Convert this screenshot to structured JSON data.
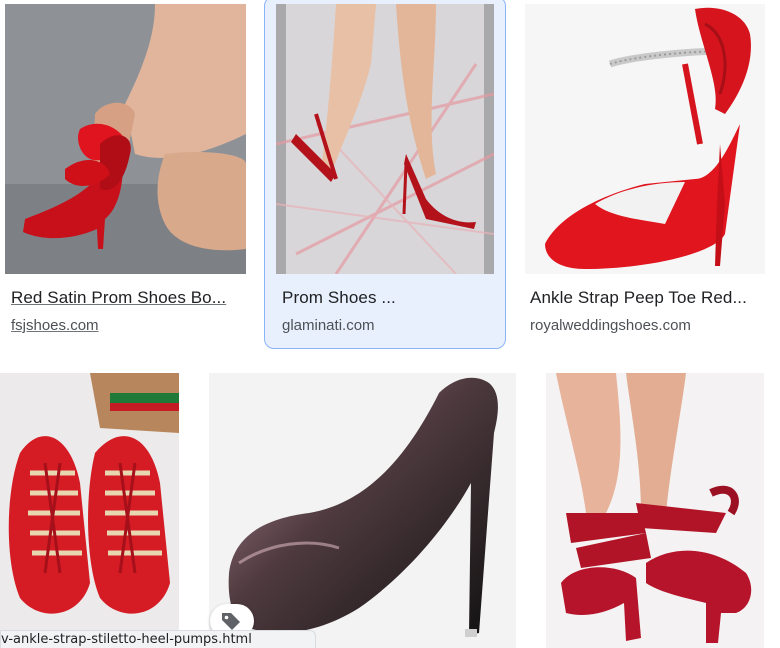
{
  "results": [
    {
      "title": "Red Satin Prom Shoes Bo...",
      "source": "fsjshoes.com"
    },
    {
      "title": "Prom Shoes ...",
      "source": "glaminati.com"
    },
    {
      "title": "Ankle Strap Peep Toe Red...",
      "source": "royalweddingshoes.com"
    }
  ],
  "status_url": "v-ankle-strap-stiletto-heel-pumps.html",
  "icons": {
    "tag": "tag-icon"
  },
  "colors": {
    "selected_card_bg": "#e8f0fe",
    "selected_card_border": "#8ab4f8",
    "title_text": "#202124",
    "source_text": "#4d5156"
  }
}
